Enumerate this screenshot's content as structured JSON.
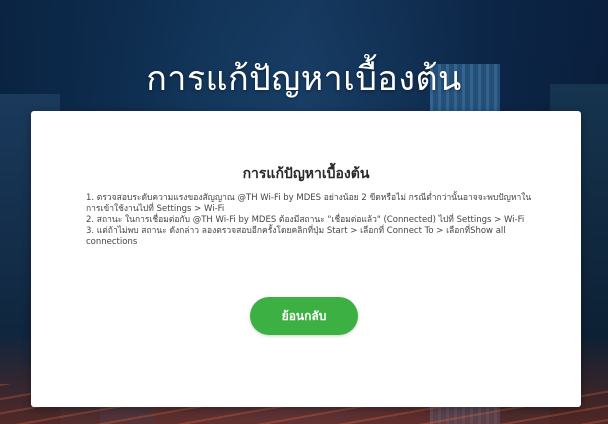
{
  "hero": {
    "title": "การแก้ปัญหาเบื้องต้น"
  },
  "card": {
    "title": "การแก้ปัญหาเบื้องต้น",
    "steps": [
      "1. ตรวจสอบระดับความแรงของสัญญาณ @TH Wi-Fi by MDES อย่างน้อย 2 ขีดหรือไม่ กรณีต่ำกว่านั้นอาจจะพบปัญหาในการเข้าใช้งานไปที่ Settings > Wi-Fi",
      "2. สถานะ ในการเชื่อมต่อกับ @TH Wi-Fi by MDES ต้องมีสถานะ \"เชื่อมต่อแล้ว\" (Connected) ไปที่ Settings > Wi-Fi",
      "3. แต่ถ้าไม่พบ สถานะ ดังกล่าว ลองตรวจสอบอีกครั้งโดยคลิกที่ปุ่ม Start > เลือกที่ Connect To > เลือกที่Show all connections"
    ],
    "back_button_label": "ย้อนกลับ"
  },
  "colors": {
    "button": "#3cb043",
    "card": "#ffffff"
  }
}
